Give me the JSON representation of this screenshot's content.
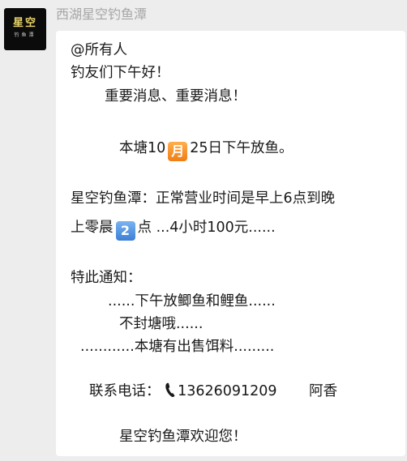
{
  "sender": {
    "name": "西湖星空钓鱼潭",
    "avatar_text_top": "星空",
    "avatar_text_bottom": "钓鱼潭"
  },
  "message": {
    "mention": "@所有人",
    "greeting": "钓友们下午好！",
    "important": "重要消息、重要消息！",
    "release_before": "本塘10",
    "release_month_emoji": "月",
    "release_after": "25日下午放鱼。",
    "hours_line1": "星空钓鱼潭：正常营业时间是早上6点到晚",
    "hours_line2_before": "上零晨",
    "hours_emoji": "2",
    "hours_line2_after": "点 ...4小时100元......",
    "notice_title": "特此通知：",
    "notice_fish": "......下午放鲫鱼和鲤鱼......",
    "notice_pond": "不封塘哦......",
    "notice_bait": "............本塘有出售饵料.........",
    "contact_label": "联系电话：",
    "phone_icon": "phone-icon",
    "contact_phone": "13626091209",
    "contact_name": "阿香",
    "welcome": "星空钓鱼潭欢迎您！"
  }
}
